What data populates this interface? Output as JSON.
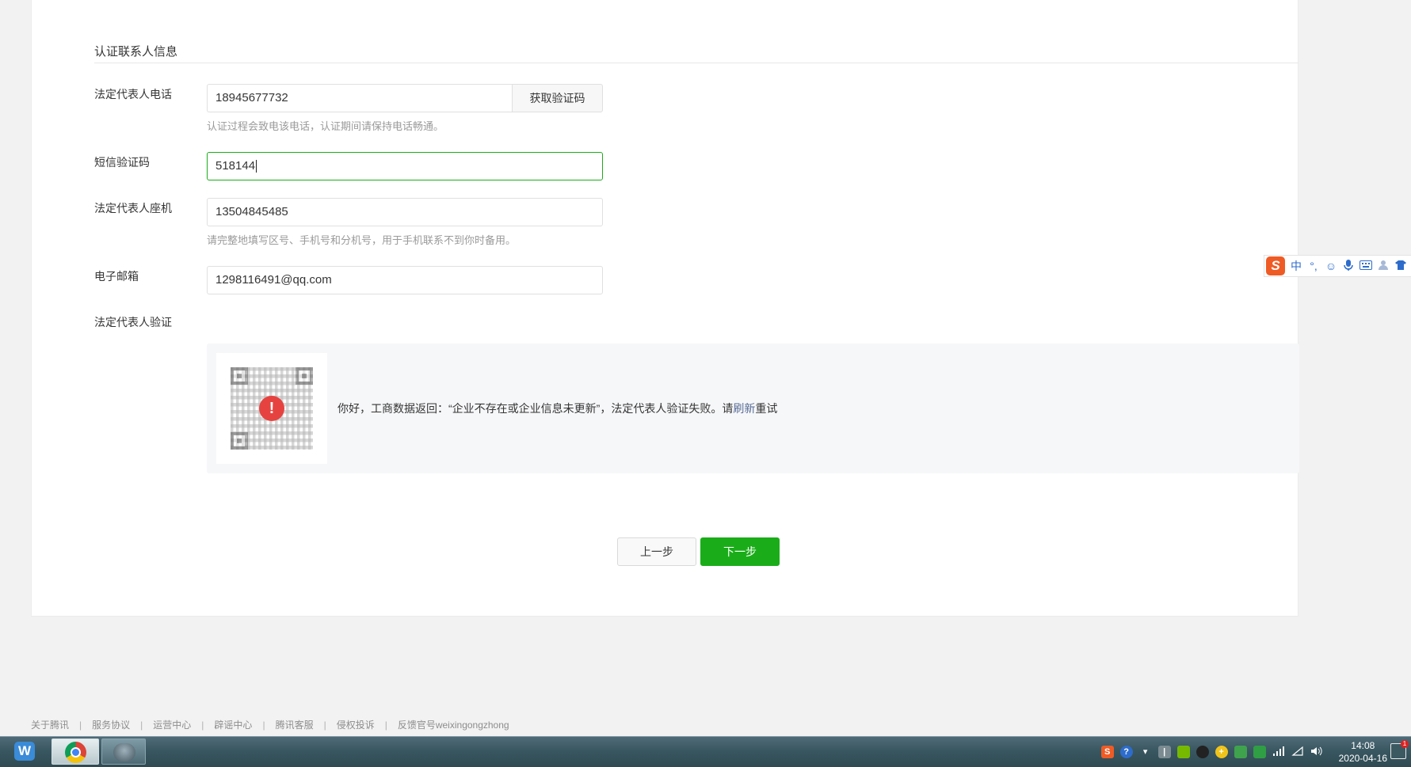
{
  "section": {
    "title": "认证联系人信息"
  },
  "form": {
    "phone": {
      "label": "法定代表人电话",
      "value": "18945677732",
      "button": "获取验证码",
      "hint": "认证过程会致电该电话，认证期间请保持电话畅通。"
    },
    "sms": {
      "label": "短信验证码",
      "value": "518144"
    },
    "landline": {
      "label": "法定代表人座机",
      "value": "13504845485",
      "hint": "请完整地填写区号、手机号和分机号，用于手机联系不到你时备用。"
    },
    "email": {
      "label": "电子邮箱",
      "value": "1298116491@qq.com"
    },
    "verify": {
      "label": "法定代表人验证",
      "alert_symbol": "!",
      "message_before": "你好，工商数据返回：“企业不存在或企业信息未更新”，法定代表人验证失败。请",
      "refresh_link": "刷新",
      "message_after": "重试"
    }
  },
  "actions": {
    "prev": "上一步",
    "next": "下一步"
  },
  "footer": {
    "links": [
      "关于腾讯",
      "服务协议",
      "运营中心",
      "辟谣中心",
      "腾讯客服",
      "侵权投诉",
      "反馈官号weixingongzhong"
    ],
    "separator": "|"
  },
  "ime": {
    "logo": "S",
    "mode": "中",
    "punct": "°,",
    "emoji": "☺",
    "items": [
      "emoji-icon",
      "microphone-icon",
      "keyboard-icon",
      "user-icon",
      "skin-icon"
    ]
  },
  "taskbar": {
    "wps_label": "W",
    "clock": {
      "time": "14:08",
      "date": "2020-04-16"
    },
    "notif_count": "1"
  },
  "colors": {
    "accent": "#1aad19",
    "link": "#576b95",
    "alert": "#e64340"
  }
}
